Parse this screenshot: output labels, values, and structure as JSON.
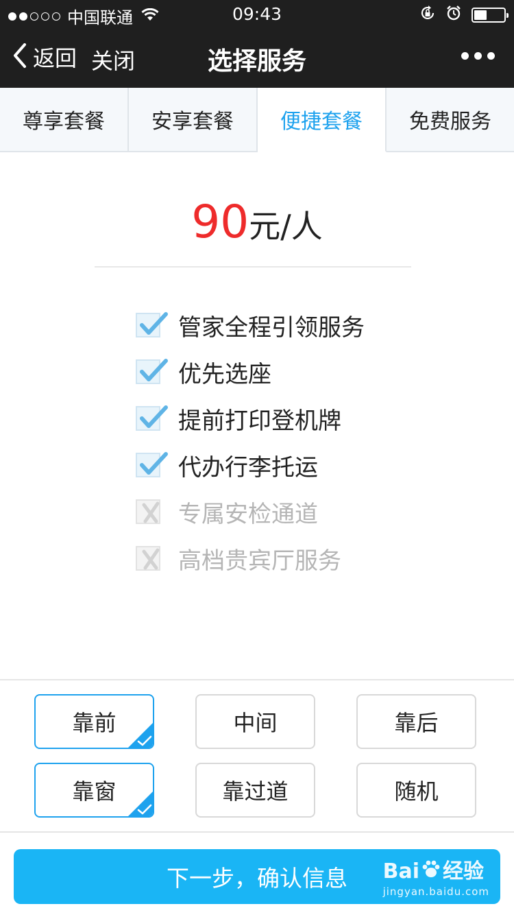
{
  "status_bar": {
    "carrier": "中国联通",
    "time": "09:43",
    "battery_level": 0.42
  },
  "nav": {
    "back_label": "返回",
    "close_label": "关闭",
    "title": "选择服务"
  },
  "tabs": [
    {
      "label": "尊享套餐",
      "active": false
    },
    {
      "label": "安享套餐",
      "active": false
    },
    {
      "label": "便捷套餐",
      "active": true
    },
    {
      "label": "免费服务",
      "active": false
    }
  ],
  "price": {
    "amount": "90",
    "unit": "元/人"
  },
  "features": [
    {
      "label": "管家全程引领服务",
      "included": true
    },
    {
      "label": "优先选座",
      "included": true
    },
    {
      "label": "提前打印登机牌",
      "included": true
    },
    {
      "label": "代办行李托运",
      "included": true
    },
    {
      "label": "专属安检通道",
      "included": false
    },
    {
      "label": "高档贵宾厅服务",
      "included": false
    }
  ],
  "seat_options": [
    {
      "label": "靠前",
      "selected": true
    },
    {
      "label": "中间",
      "selected": false
    },
    {
      "label": "靠后",
      "selected": false
    },
    {
      "label": "靠窗",
      "selected": true
    },
    {
      "label": "靠过道",
      "selected": false
    },
    {
      "label": "随机",
      "selected": false
    }
  ],
  "next_button": {
    "label": "下一步，确认信息"
  },
  "watermark": {
    "brand_left": "Bai",
    "brand_right": "经验",
    "url": "jingyan.baidu.com"
  },
  "colors": {
    "accent": "#1ea2ee",
    "price_red": "#ee2b2b",
    "button_blue": "#1ab5f5",
    "header_bg": "#1f1f1f"
  },
  "icons": [
    "back-chevron-icon",
    "wifi-icon",
    "orientation-lock-icon",
    "alarm-icon",
    "battery-icon",
    "more-icon",
    "check-icon",
    "cross-icon",
    "paw-icon"
  ]
}
